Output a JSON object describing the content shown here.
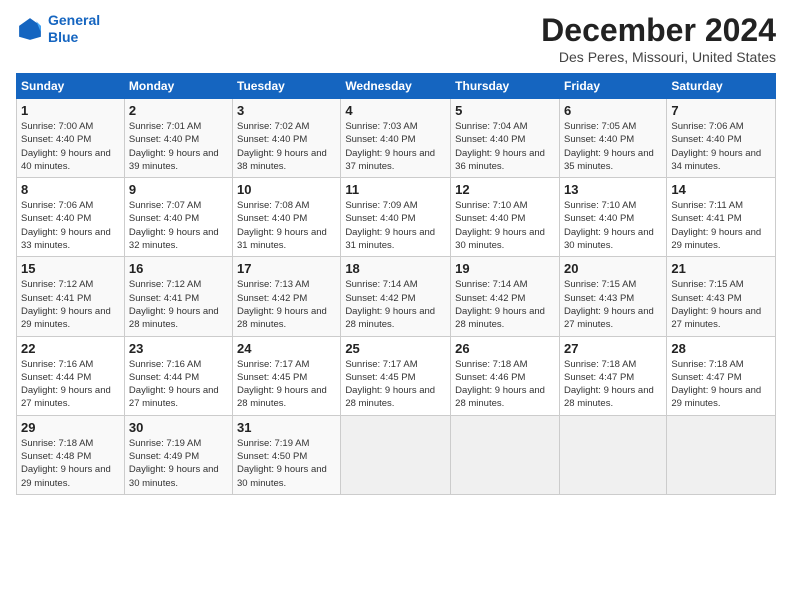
{
  "logo": {
    "line1": "General",
    "line2": "Blue"
  },
  "title": "December 2024",
  "subtitle": "Des Peres, Missouri, United States",
  "header": {
    "days": [
      "Sunday",
      "Monday",
      "Tuesday",
      "Wednesday",
      "Thursday",
      "Friday",
      "Saturday"
    ]
  },
  "weeks": [
    [
      {
        "day": "1",
        "rise": "7:00 AM",
        "set": "4:40 PM",
        "daylight": "9 hours and 40 minutes."
      },
      {
        "day": "2",
        "rise": "7:01 AM",
        "set": "4:40 PM",
        "daylight": "9 hours and 39 minutes."
      },
      {
        "day": "3",
        "rise": "7:02 AM",
        "set": "4:40 PM",
        "daylight": "9 hours and 38 minutes."
      },
      {
        "day": "4",
        "rise": "7:03 AM",
        "set": "4:40 PM",
        "daylight": "9 hours and 37 minutes."
      },
      {
        "day": "5",
        "rise": "7:04 AM",
        "set": "4:40 PM",
        "daylight": "9 hours and 36 minutes."
      },
      {
        "day": "6",
        "rise": "7:05 AM",
        "set": "4:40 PM",
        "daylight": "9 hours and 35 minutes."
      },
      {
        "day": "7",
        "rise": "7:06 AM",
        "set": "4:40 PM",
        "daylight": "9 hours and 34 minutes."
      }
    ],
    [
      {
        "day": "8",
        "rise": "7:06 AM",
        "set": "4:40 PM",
        "daylight": "9 hours and 33 minutes."
      },
      {
        "day": "9",
        "rise": "7:07 AM",
        "set": "4:40 PM",
        "daylight": "9 hours and 32 minutes."
      },
      {
        "day": "10",
        "rise": "7:08 AM",
        "set": "4:40 PM",
        "daylight": "9 hours and 31 minutes."
      },
      {
        "day": "11",
        "rise": "7:09 AM",
        "set": "4:40 PM",
        "daylight": "9 hours and 31 minutes."
      },
      {
        "day": "12",
        "rise": "7:10 AM",
        "set": "4:40 PM",
        "daylight": "9 hours and 30 minutes."
      },
      {
        "day": "13",
        "rise": "7:10 AM",
        "set": "4:40 PM",
        "daylight": "9 hours and 30 minutes."
      },
      {
        "day": "14",
        "rise": "7:11 AM",
        "set": "4:41 PM",
        "daylight": "9 hours and 29 minutes."
      }
    ],
    [
      {
        "day": "15",
        "rise": "7:12 AM",
        "set": "4:41 PM",
        "daylight": "9 hours and 29 minutes."
      },
      {
        "day": "16",
        "rise": "7:12 AM",
        "set": "4:41 PM",
        "daylight": "9 hours and 28 minutes."
      },
      {
        "day": "17",
        "rise": "7:13 AM",
        "set": "4:42 PM",
        "daylight": "9 hours and 28 minutes."
      },
      {
        "day": "18",
        "rise": "7:14 AM",
        "set": "4:42 PM",
        "daylight": "9 hours and 28 minutes."
      },
      {
        "day": "19",
        "rise": "7:14 AM",
        "set": "4:42 PM",
        "daylight": "9 hours and 28 minutes."
      },
      {
        "day": "20",
        "rise": "7:15 AM",
        "set": "4:43 PM",
        "daylight": "9 hours and 27 minutes."
      },
      {
        "day": "21",
        "rise": "7:15 AM",
        "set": "4:43 PM",
        "daylight": "9 hours and 27 minutes."
      }
    ],
    [
      {
        "day": "22",
        "rise": "7:16 AM",
        "set": "4:44 PM",
        "daylight": "9 hours and 27 minutes."
      },
      {
        "day": "23",
        "rise": "7:16 AM",
        "set": "4:44 PM",
        "daylight": "9 hours and 27 minutes."
      },
      {
        "day": "24",
        "rise": "7:17 AM",
        "set": "4:45 PM",
        "daylight": "9 hours and 28 minutes."
      },
      {
        "day": "25",
        "rise": "7:17 AM",
        "set": "4:45 PM",
        "daylight": "9 hours and 28 minutes."
      },
      {
        "day": "26",
        "rise": "7:18 AM",
        "set": "4:46 PM",
        "daylight": "9 hours and 28 minutes."
      },
      {
        "day": "27",
        "rise": "7:18 AM",
        "set": "4:47 PM",
        "daylight": "9 hours and 28 minutes."
      },
      {
        "day": "28",
        "rise": "7:18 AM",
        "set": "4:47 PM",
        "daylight": "9 hours and 29 minutes."
      }
    ],
    [
      {
        "day": "29",
        "rise": "7:18 AM",
        "set": "4:48 PM",
        "daylight": "9 hours and 29 minutes."
      },
      {
        "day": "30",
        "rise": "7:19 AM",
        "set": "4:49 PM",
        "daylight": "9 hours and 30 minutes."
      },
      {
        "day": "31",
        "rise": "7:19 AM",
        "set": "4:50 PM",
        "daylight": "9 hours and 30 minutes."
      },
      null,
      null,
      null,
      null
    ]
  ]
}
